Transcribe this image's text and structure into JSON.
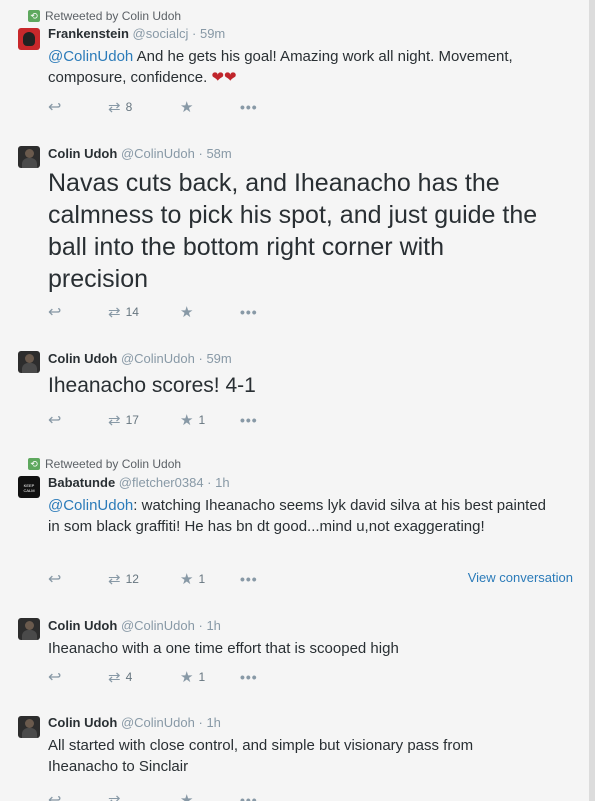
{
  "tweets": [
    {
      "context": "Retweeted by Colin Udoh",
      "fullname": "Frankenstein",
      "handle": "@socialcj",
      "time": "59m",
      "mention": "@ColinUdoh",
      "text": " And he gets his goal! Amazing work all night. Movement, composure, confidence. ",
      "emoji": "❤❤",
      "retweets": "8",
      "favorites": ""
    },
    {
      "fullname": "Colin Udoh",
      "handle": "@ColinUdoh",
      "time": "58m",
      "text": "Navas cuts back, and Iheanacho has the calmness to pick his spot, and just guide the ball into the bottom right corner with precision",
      "retweets": "14",
      "favorites": ""
    },
    {
      "fullname": "Colin Udoh",
      "handle": "@ColinUdoh",
      "time": "59m",
      "text": "Iheanacho scores! 4-1",
      "retweets": "17",
      "favorites": "1"
    },
    {
      "context": "Retweeted by Colin Udoh",
      "fullname": "Babatunde",
      "handle": "@fletcher0384",
      "time": "1h",
      "mention": "@ColinUdoh",
      "text": ": watching Iheanacho seems lyk david silva at his best painted in som black graffiti! He has bn dt good...mind u,not exaggerating!",
      "retweets": "12",
      "favorites": "1",
      "view_conversation": "View conversation"
    },
    {
      "fullname": "Colin Udoh",
      "handle": "@ColinUdoh",
      "time": "1h",
      "text": "Iheanacho with a one time effort that is scooped high",
      "retweets": "4",
      "favorites": "1"
    },
    {
      "fullname": "Colin Udoh",
      "handle": "@ColinUdoh",
      "time": "1h",
      "text": "All started with close control, and simple but visionary pass from Iheanacho to Sinclair",
      "retweets": "",
      "favorites": ""
    }
  ],
  "separator": "·",
  "icons": {
    "reply": "reply-icon",
    "retweet": "retweet-icon",
    "favorite": "star-icon",
    "more": "more-icon"
  },
  "colors": {
    "link": "#2b7bb9",
    "retweet_badge": "#5ea85e",
    "heart": "#c0252b"
  }
}
